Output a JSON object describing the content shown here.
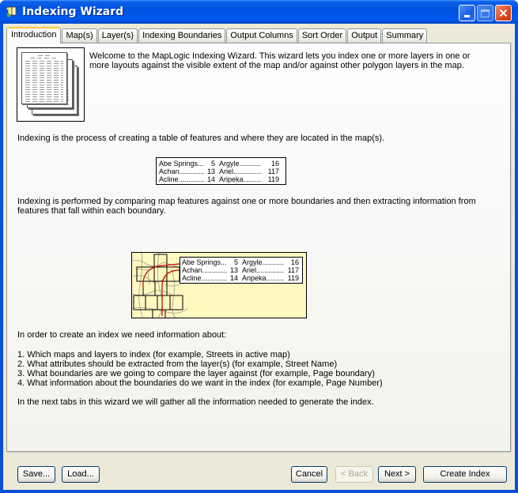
{
  "window": {
    "title": "Indexing Wizard",
    "icon": "wizard-book-icon",
    "controls": {
      "minimize": "minimize-icon",
      "maximize": "maximize-icon",
      "close": "close-icon"
    }
  },
  "tabs": [
    {
      "label": "Introduction",
      "active": true
    },
    {
      "label": "Map(s)",
      "active": false
    },
    {
      "label": "Layer(s)",
      "active": false
    },
    {
      "label": "Indexing Boundaries",
      "active": false
    },
    {
      "label": "Output Columns",
      "active": false
    },
    {
      "label": "Sort Order",
      "active": false
    },
    {
      "label": "Output",
      "active": false
    },
    {
      "label": "Summary",
      "active": false
    }
  ],
  "intro": {
    "welcome_line1": "Welcome to the MapLogic Indexing Wizard.  This wizard lets you index one or more layers in one or",
    "welcome_line2": "more layouts against the visible extent of the map and/or against other polygon layers in the map.",
    "definition": "Indexing is the process of creating a table of features and where they are located in the map(s).",
    "method_line1": "Indexing is performed by comparing map features against one or more boundaries and then extracting information from",
    "method_line2": "features that fall within each boundary.",
    "need_info": "In order to create an index we need information about:",
    "requirements": [
      "1.  Which maps and layers to index (for example, Streets in active map)",
      "2.  What attributes should be extracted from the layer(s) (for example, Street Name)",
      "3.  What boundaries are we going to compare the layer against (for example, Page boundary)",
      "4.  What information about the boundaries do we want in the index (for example, Page Number)"
    ],
    "next_steps": "In the next tabs in this wizard we will gather all the information needed to generate the index."
  },
  "sample_index": [
    {
      "name1": "Abe Springs....",
      "page1": "5",
      "name2": "Argyle...........",
      "page2": "16"
    },
    {
      "name1": "Achan..............",
      "page1": "13",
      "name2": "Ariel...............",
      "page2": "117"
    },
    {
      "name1": "Acline..............",
      "page1": "14",
      "name2": "Aripeka.........",
      "page2": "119"
    }
  ],
  "buttons": {
    "save": "Save...",
    "load": "Load...",
    "cancel": "Cancel",
    "back": "< Back",
    "next": "Next >",
    "create": "Create Index"
  },
  "colors": {
    "titlebar": "#0054e3",
    "active_tab_accent": "#ffc83c",
    "map_background": "#fff8c0",
    "route_arrow": "#c00000"
  }
}
